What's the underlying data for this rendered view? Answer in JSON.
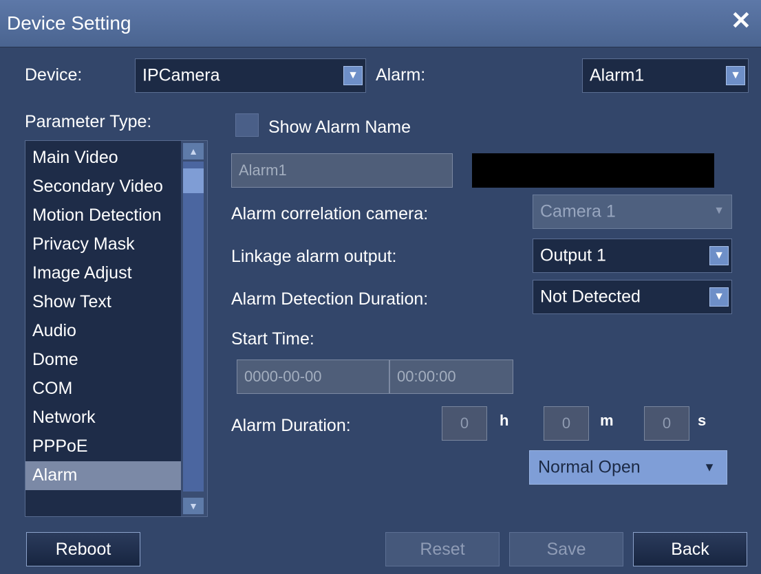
{
  "window": {
    "title": "Device Setting",
    "close_glyph": "✕"
  },
  "device": {
    "label": "Device:",
    "value": "IPCamera"
  },
  "alarm": {
    "label": "Alarm:",
    "value": "Alarm1"
  },
  "parameter_type": {
    "label": "Parameter Type:",
    "items": [
      "Main Video",
      "Secondary Video",
      "Motion Detection",
      "Privacy Mask",
      "Image Adjust",
      "Show Text",
      "Audio",
      "Dome",
      "COM",
      "Network",
      "PPPoE",
      "Alarm"
    ],
    "selected": "Alarm"
  },
  "show_alarm_name": {
    "label": "Show Alarm Name",
    "checked": false
  },
  "alarm_name_field": {
    "value": "Alarm1"
  },
  "correlation_camera": {
    "label": "Alarm correlation camera:",
    "value": "Camera 1"
  },
  "linkage_output": {
    "label": "Linkage alarm output:",
    "value": "Output 1"
  },
  "detection_duration": {
    "label": "Alarm Detection Duration:",
    "value": "Not Detected"
  },
  "start_time": {
    "label": "Start Time:",
    "date": "0000-00-00",
    "time": "00:00:00"
  },
  "alarm_duration": {
    "label": "Alarm Duration:",
    "hours": "0",
    "h": "h",
    "minutes": "0",
    "m": "m",
    "seconds": "0",
    "s": "s"
  },
  "alarm_mode": {
    "value": "Normal Open"
  },
  "buttons": {
    "reboot": "Reboot",
    "reset": "Reset",
    "save": "Save",
    "back": "Back"
  },
  "colors": {
    "background": "#33466a",
    "titlebar": "#5d78a8",
    "selected_item": "#7b89a6",
    "accent_dropdown": "#7f9ed7"
  }
}
